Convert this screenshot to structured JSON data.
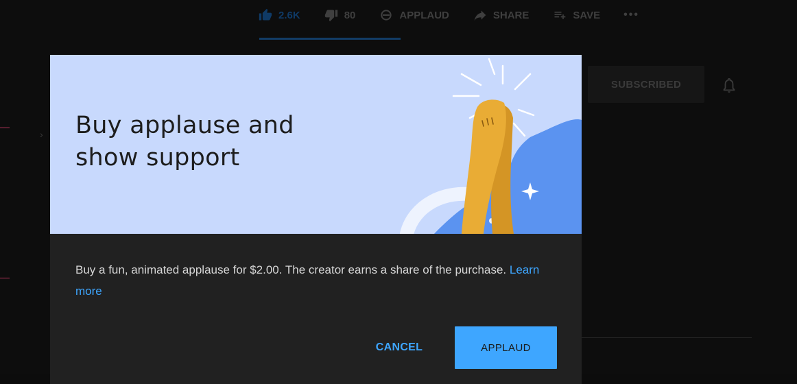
{
  "background": {
    "actions": {
      "like_count": "2.6K",
      "dislike_count": "80",
      "applaud_label": "APPLAUD",
      "share_label": "SHARE",
      "save_label": "SAVE",
      "more_label": "•••"
    },
    "subscribe_label": "SUBSCRIBED"
  },
  "dialog": {
    "title_line1": "Buy applause and",
    "title_line2": "show support",
    "body": "Buy a fun, animated applause for $2.00. The creator earns a share of the purchase.",
    "learn_more": "Learn more",
    "cancel_label": "CANCEL",
    "confirm_label": "APPLAUD"
  },
  "colors": {
    "hero_bg": "#c8d9fd",
    "dialog_bg": "#212121",
    "accent": "#3ea6ff",
    "hand_gold": "#e9ac35",
    "blob_blue": "#5b93f0"
  },
  "icons": [
    "thumb-up-icon",
    "thumb-down-icon",
    "applaud-icon",
    "share-icon",
    "save-playlist-icon",
    "more-icon",
    "bell-icon",
    "clapping-hands-illustration"
  ]
}
